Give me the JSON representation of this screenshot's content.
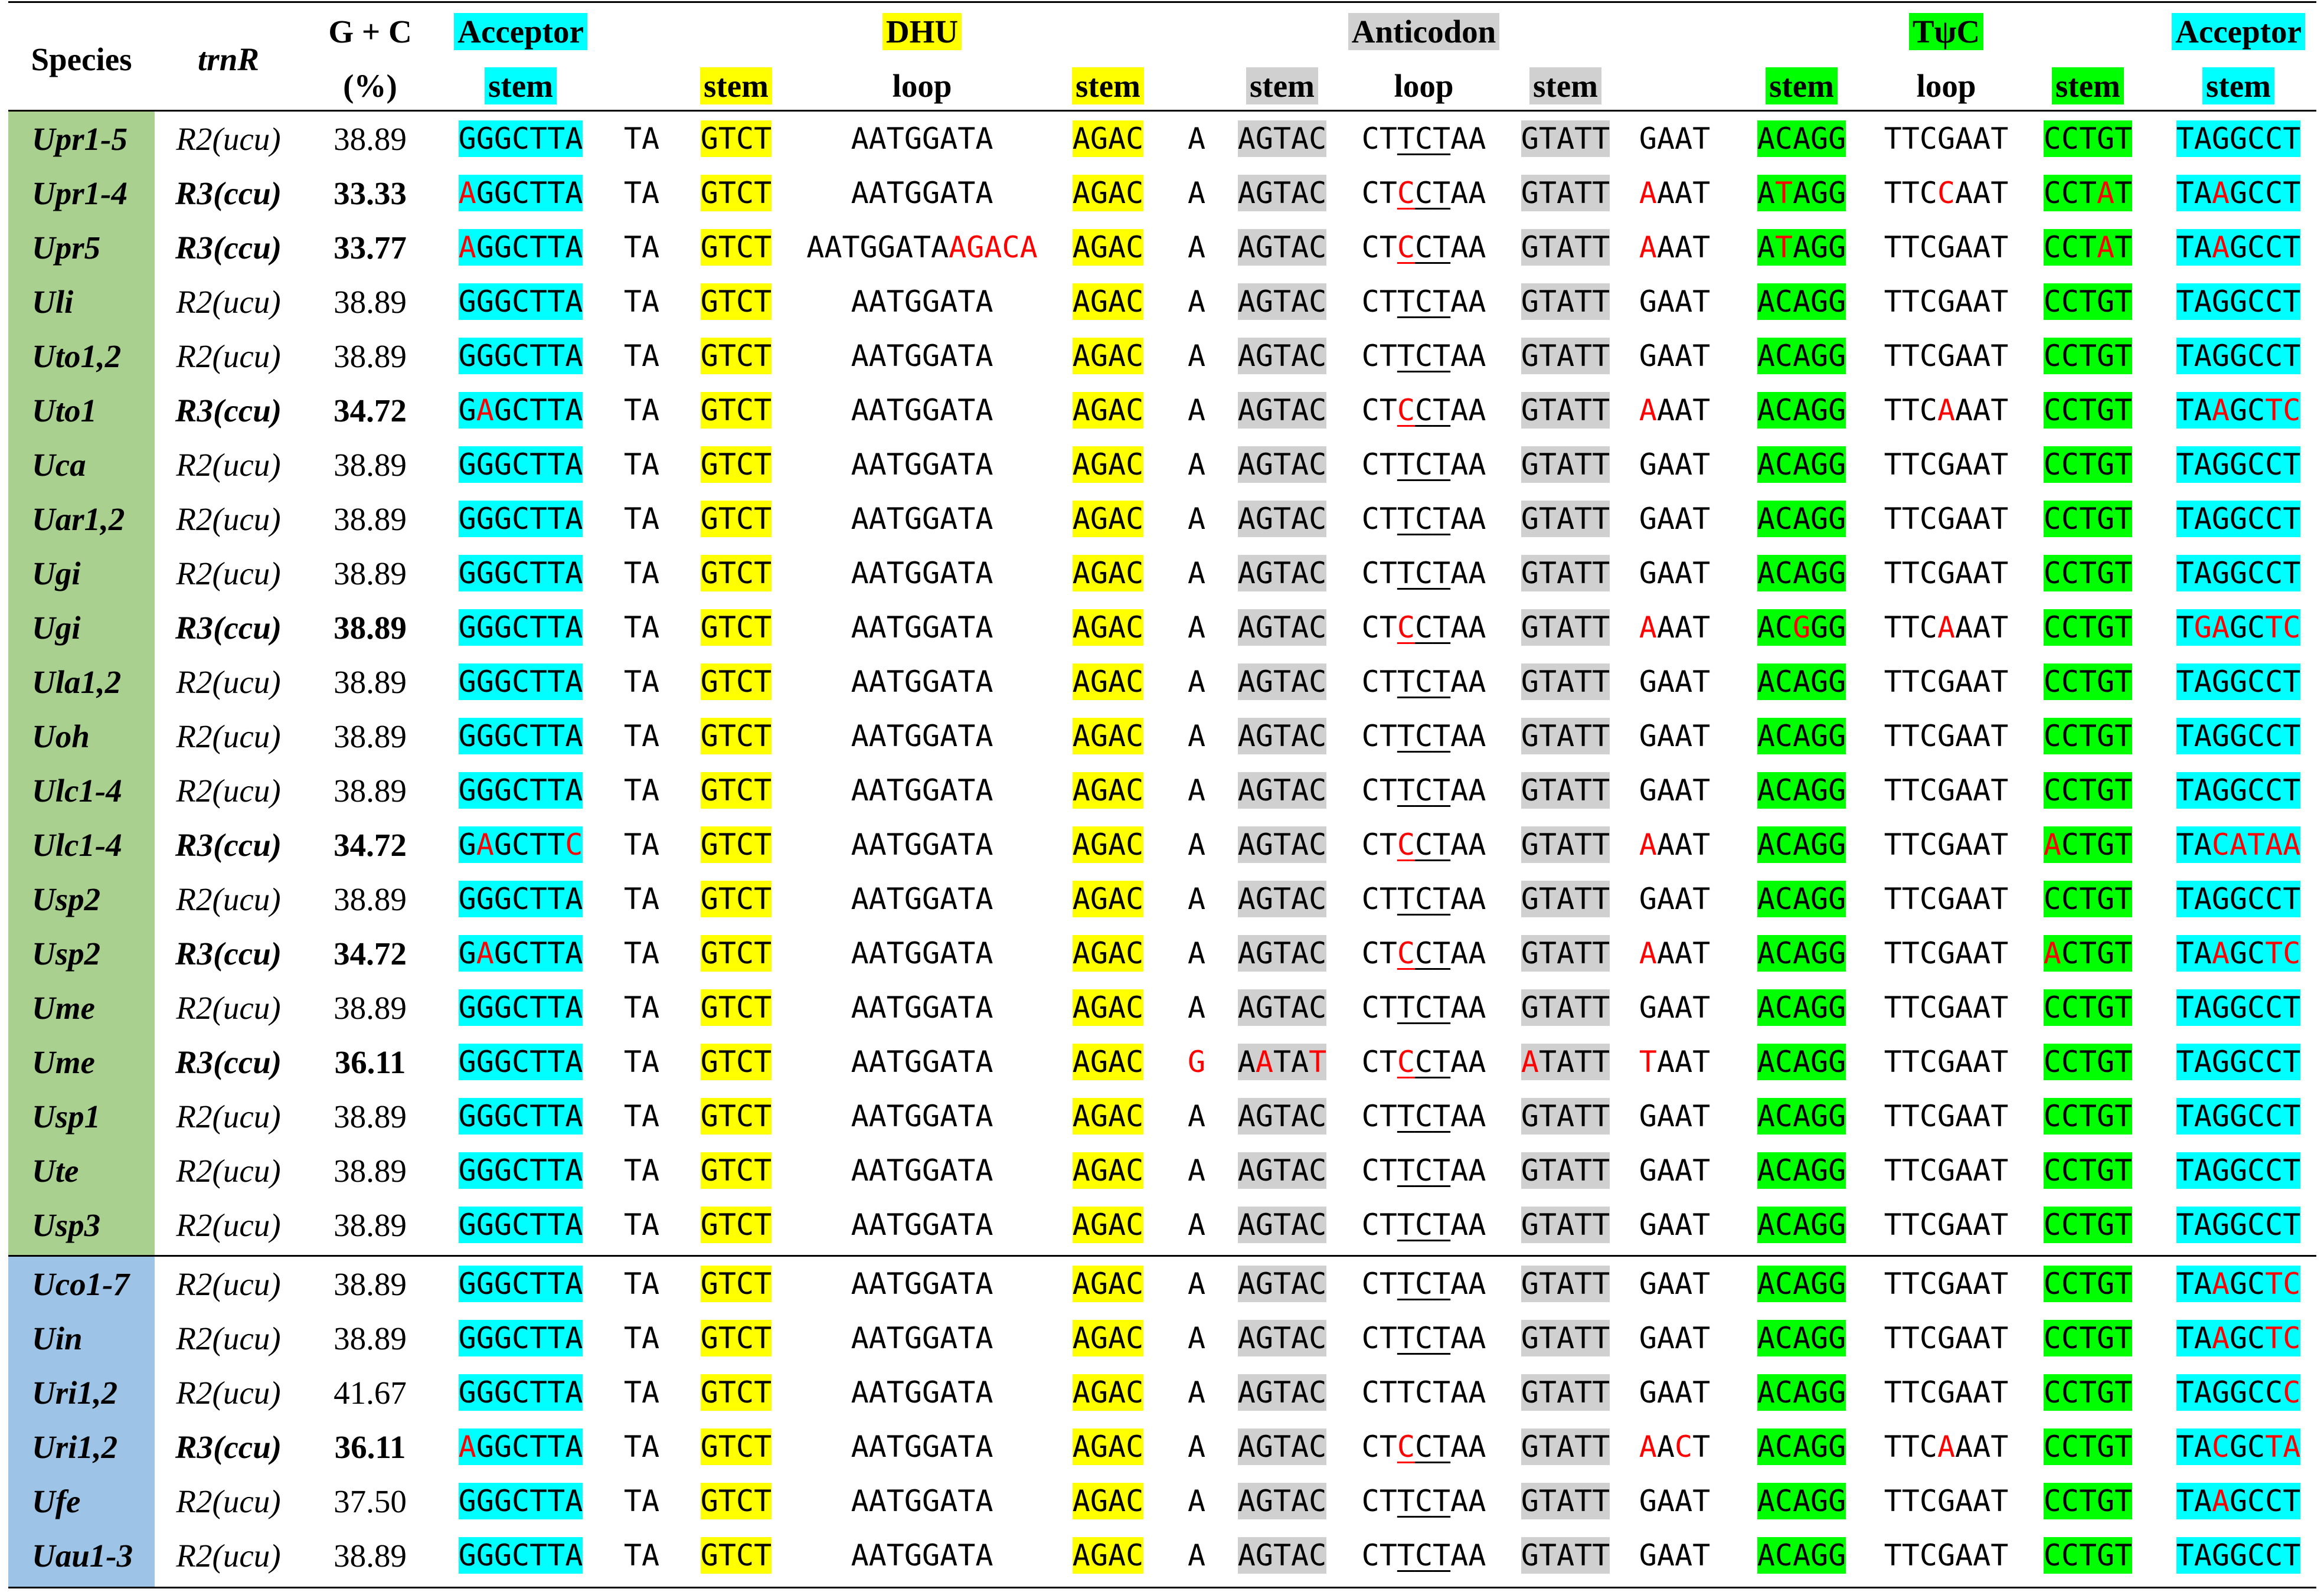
{
  "colors": {
    "acceptor": "#00ffff",
    "dhu": "#ffff00",
    "anticodon": "#d0d0d0",
    "tpsic": "#00ff00",
    "group_a": "#a9d08e",
    "group_b": "#9dc3e6",
    "mutation": "#ff0000"
  },
  "header": {
    "species": "Species",
    "trnr": "trnR",
    "gc_top": "G + C",
    "gc_bottom": "(%)",
    "acceptor_top": "Acceptor",
    "acceptor_stem": "stem",
    "dhu_top": "DHU",
    "dhu_stem1": "stem",
    "dhu_loop": "loop",
    "dhu_stem2": "stem",
    "anticodon_top": "Anticodon",
    "anticodon_stem1": "stem",
    "anticodon_loop": "loop",
    "anticodon_stem2": "stem",
    "tpsic_top": "TψC",
    "tpsic_stem1": "stem",
    "tpsic_loop": "loop",
    "tpsic_stem2": "stem",
    "acceptor2_top": "Acceptor",
    "acceptor2_stem": "stem"
  },
  "rows": [
    {
      "species": "Upr1-5",
      "group": "a",
      "trnr": "R2(ucu)",
      "bold": false,
      "gc": "38.89",
      "cols": [
        "GGGCTTA",
        "TA",
        "GTCT",
        "AATGGATA",
        "AGAC",
        "A",
        "AGTAC",
        "CTTCTAA",
        "GTATT",
        "GAAT",
        "ACAGG",
        "TTCGAAT",
        "CCTGT",
        "TAGGCCT"
      ]
    },
    {
      "species": "Upr1-4",
      "group": "a",
      "trnr": "R3(ccu)",
      "bold": true,
      "gc": "33.33",
      "cols": [
        "AGGCTTA",
        "TA",
        "GTCT",
        "AATGGATA",
        "AGAC",
        "A",
        "AGTAC",
        "CTCCTAA",
        "GTATT",
        "AAAT",
        "ATAGG",
        "TTCCAAT",
        "CCTAT",
        "TAAGCCT"
      ]
    },
    {
      "species": "Upr5",
      "group": "a",
      "trnr": "R3(ccu)",
      "bold": true,
      "gc": "33.77",
      "cols": [
        "AGGCTTA",
        "TA",
        "GTCT",
        "AATGGATAAGACA",
        "AGAC",
        "A",
        "AGTAC",
        "CTCCTAA",
        "GTATT",
        "AAAT",
        "ATAGG",
        "TTCGAAT",
        "CCTAT",
        "TAAGCCT"
      ]
    },
    {
      "species": "Uli",
      "group": "a",
      "trnr": "R2(ucu)",
      "bold": false,
      "gc": "38.89",
      "cols": [
        "GGGCTTA",
        "TA",
        "GTCT",
        "AATGGATA",
        "AGAC",
        "A",
        "AGTAC",
        "CTTCTAA",
        "GTATT",
        "GAAT",
        "ACAGG",
        "TTCGAAT",
        "CCTGT",
        "TAGGCCT"
      ]
    },
    {
      "species": "Uto1,2",
      "group": "a",
      "trnr": "R2(ucu)",
      "bold": false,
      "gc": "38.89",
      "cols": [
        "GGGCTTA",
        "TA",
        "GTCT",
        "AATGGATA",
        "AGAC",
        "A",
        "AGTAC",
        "CTTCTAA",
        "GTATT",
        "GAAT",
        "ACAGG",
        "TTCGAAT",
        "CCTGT",
        "TAGGCCT"
      ]
    },
    {
      "species": "Uto1",
      "group": "a",
      "trnr": "R3(ccu)",
      "bold": true,
      "gc": "34.72",
      "cols": [
        "GAGCTTA",
        "TA",
        "GTCT",
        "AATGGATA",
        "AGAC",
        "A",
        "AGTAC",
        "CTCCTAA",
        "GTATT",
        "AAAT",
        "ACAGG",
        "TTCAAAT",
        "CCTGT",
        "TAAGCTC"
      ]
    },
    {
      "species": "Uca",
      "group": "a",
      "trnr": "R2(ucu)",
      "bold": false,
      "gc": "38.89",
      "cols": [
        "GGGCTTA",
        "TA",
        "GTCT",
        "AATGGATA",
        "AGAC",
        "A",
        "AGTAC",
        "CTTCTAA",
        "GTATT",
        "GAAT",
        "ACAGG",
        "TTCGAAT",
        "CCTGT",
        "TAGGCCT"
      ]
    },
    {
      "species": "Uar1,2",
      "group": "a",
      "trnr": "R2(ucu)",
      "bold": false,
      "gc": "38.89",
      "cols": [
        "GGGCTTA",
        "TA",
        "GTCT",
        "AATGGATA",
        "AGAC",
        "A",
        "AGTAC",
        "CTTCTAA",
        "GTATT",
        "GAAT",
        "ACAGG",
        "TTCGAAT",
        "CCTGT",
        "TAGGCCT"
      ]
    },
    {
      "species": "Ugi",
      "group": "a",
      "trnr": "R2(ucu)",
      "bold": false,
      "gc": "38.89",
      "cols": [
        "GGGCTTA",
        "TA",
        "GTCT",
        "AATGGATA",
        "AGAC",
        "A",
        "AGTAC",
        "CTTCTAA",
        "GTATT",
        "GAAT",
        "ACAGG",
        "TTCGAAT",
        "CCTGT",
        "TAGGCCT"
      ]
    },
    {
      "species": "Ugi",
      "group": "a",
      "trnr": "R3(ccu)",
      "bold": true,
      "gc": "38.89",
      "cols": [
        "GGGCTTA",
        "TA",
        "GTCT",
        "AATGGATA",
        "AGAC",
        "A",
        "AGTAC",
        "CTCCTAA",
        "GTATT",
        "AAAT",
        "ACGGG",
        "TTCAAAT",
        "CCTGT",
        "TGAGCTC"
      ]
    },
    {
      "species": "Ula1,2",
      "group": "a",
      "trnr": "R2(ucu)",
      "bold": false,
      "gc": "38.89",
      "cols": [
        "GGGCTTA",
        "TA",
        "GTCT",
        "AATGGATA",
        "AGAC",
        "A",
        "AGTAC",
        "CTTCTAA",
        "GTATT",
        "GAAT",
        "ACAGG",
        "TTCGAAT",
        "CCTGT",
        "TAGGCCT"
      ]
    },
    {
      "species": "Uoh",
      "group": "a",
      "trnr": "R2(ucu)",
      "bold": false,
      "gc": "38.89",
      "cols": [
        "GGGCTTA",
        "TA",
        "GTCT",
        "AATGGATA",
        "AGAC",
        "A",
        "AGTAC",
        "CTTCTAA",
        "GTATT",
        "GAAT",
        "ACAGG",
        "TTCGAAT",
        "CCTGT",
        "TAGGCCT"
      ]
    },
    {
      "species": "Ulc1-4",
      "group": "a",
      "trnr": "R2(ucu)",
      "bold": false,
      "gc": "38.89",
      "cols": [
        "GGGCTTA",
        "TA",
        "GTCT",
        "AATGGATA",
        "AGAC",
        "A",
        "AGTAC",
        "CTTCTAA",
        "GTATT",
        "GAAT",
        "ACAGG",
        "TTCGAAT",
        "CCTGT",
        "TAGGCCT"
      ]
    },
    {
      "species": "Ulc1-4",
      "group": "a",
      "trnr": "R3(ccu)",
      "bold": true,
      "gc": "34.72",
      "cols": [
        "GAGCTTC",
        "TA",
        "GTCT",
        "AATGGATA",
        "AGAC",
        "A",
        "AGTAC",
        "CTCCTAA",
        "GTATT",
        "AAAT",
        "ACAGG",
        "TTCGAAT",
        "ACTGT",
        "TACATAA"
      ]
    },
    {
      "species": "Usp2",
      "group": "a",
      "trnr": "R2(ucu)",
      "bold": false,
      "gc": "38.89",
      "cols": [
        "GGGCTTA",
        "TA",
        "GTCT",
        "AATGGATA",
        "AGAC",
        "A",
        "AGTAC",
        "CTTCTAA",
        "GTATT",
        "GAAT",
        "ACAGG",
        "TTCGAAT",
        "CCTGT",
        "TAGGCCT"
      ]
    },
    {
      "species": "Usp2",
      "group": "a",
      "trnr": "R3(ccu)",
      "bold": true,
      "gc": "34.72",
      "cols": [
        "GAGCTTA",
        "TA",
        "GTCT",
        "AATGGATA",
        "AGAC",
        "A",
        "AGTAC",
        "CTCCTAA",
        "GTATT",
        "AAAT",
        "ACAGG",
        "TTCGAAT",
        "ACTGT",
        "TAAGCTC"
      ]
    },
    {
      "species": "Ume",
      "group": "a",
      "trnr": "R2(ucu)",
      "bold": false,
      "gc": "38.89",
      "cols": [
        "GGGCTTA",
        "TA",
        "GTCT",
        "AATGGATA",
        "AGAC",
        "A",
        "AGTAC",
        "CTTCTAA",
        "GTATT",
        "GAAT",
        "ACAGG",
        "TTCGAAT",
        "CCTGT",
        "TAGGCCT"
      ]
    },
    {
      "species": "Ume",
      "group": "a",
      "trnr": "R3(ccu)",
      "bold": true,
      "gc": "36.11",
      "cols": [
        "GGGCTTA",
        "TA",
        "GTCT",
        "AATGGATA",
        "AGAC",
        "G",
        "AATAT",
        "CTCCTAA",
        "ATATT",
        "TAAT",
        "ACAGG",
        "TTCGAAT",
        "CCTGT",
        "TAGGCCT"
      ]
    },
    {
      "species": "Usp1",
      "group": "a",
      "trnr": "R2(ucu)",
      "bold": false,
      "gc": "38.89",
      "cols": [
        "GGGCTTA",
        "TA",
        "GTCT",
        "AATGGATA",
        "AGAC",
        "A",
        "AGTAC",
        "CTTCTAA",
        "GTATT",
        "GAAT",
        "ACAGG",
        "TTCGAAT",
        "CCTGT",
        "TAGGCCT"
      ]
    },
    {
      "species": "Ute",
      "group": "a",
      "trnr": "R2(ucu)",
      "bold": false,
      "gc": "38.89",
      "cols": [
        "GGGCTTA",
        "TA",
        "GTCT",
        "AATGGATA",
        "AGAC",
        "A",
        "AGTAC",
        "CTTCTAA",
        "GTATT",
        "GAAT",
        "ACAGG",
        "TTCGAAT",
        "CCTGT",
        "TAGGCCT"
      ]
    },
    {
      "species": "Usp3",
      "group": "a",
      "trnr": "R2(ucu)",
      "bold": false,
      "gc": "38.89",
      "cols": [
        "GGGCTTA",
        "TA",
        "GTCT",
        "AATGGATA",
        "AGAC",
        "A",
        "AGTAC",
        "CTTCTAA",
        "GTATT",
        "GAAT",
        "ACAGG",
        "TTCGAAT",
        "CCTGT",
        "TAGGCCT"
      ]
    },
    {
      "species": "Uco1-7",
      "group": "b",
      "trnr": "R2(ucu)",
      "bold": false,
      "gc": "38.89",
      "cols": [
        "GGGCTTA",
        "TA",
        "GTCT",
        "AATGGATA",
        "AGAC",
        "A",
        "AGTAC",
        "CTTCTAA",
        "GTATT",
        "GAAT",
        "ACAGG",
        "TTCGAAT",
        "CCTGT",
        "TAAGCTC"
      ]
    },
    {
      "species": "Uin",
      "group": "b",
      "trnr": "R2(ucu)",
      "bold": false,
      "gc": "38.89",
      "cols": [
        "GGGCTTA",
        "TA",
        "GTCT",
        "AATGGATA",
        "AGAC",
        "A",
        "AGTAC",
        "CTTCTAA",
        "GTATT",
        "GAAT",
        "ACAGG",
        "TTCGAAT",
        "CCTGT",
        "TAAGCTC"
      ]
    },
    {
      "species": "Uri1,2",
      "group": "b",
      "trnr": "R2(ucu)",
      "bold": false,
      "gc": "41.67",
      "cols": [
        "GGGCTTA",
        "TA",
        "GTCT",
        "AATGGATA",
        "AGAC",
        "A",
        "AGTAC",
        "CTTCTAA",
        "GTATT",
        "GAAT",
        "ACAGG",
        "TTCGAAT",
        "CCTGT",
        "TAGGCCC"
      ]
    },
    {
      "species": "Uri1,2",
      "group": "b",
      "trnr": "R3(ccu)",
      "bold": true,
      "gc": "36.11",
      "cols": [
        "AGGCTTA",
        "TA",
        "GTCT",
        "AATGGATA",
        "AGAC",
        "A",
        "AGTAC",
        "CTCCTAA",
        "GTATT",
        "AACT",
        "ACAGG",
        "TTCAAAT",
        "CCTGT",
        "TACGCTA"
      ]
    },
    {
      "species": "Ufe",
      "group": "b",
      "trnr": "R2(ucu)",
      "bold": false,
      "gc": "37.50",
      "cols": [
        "GGGCTTA",
        "TA",
        "GTCT",
        "AATGGATA",
        "AGAC",
        "A",
        "AGTAC",
        "CTTCTAA",
        "GTATT",
        "GAAT",
        "ACAGG",
        "TTCGAAT",
        "CCTGT",
        "TAAGCCT"
      ]
    },
    {
      "species": "Uau1-3",
      "group": "b",
      "trnr": "R2(ucu)",
      "bold": false,
      "gc": "38.89",
      "cols": [
        "GGGCTTA",
        "TA",
        "GTCT",
        "AATGGATA",
        "AGAC",
        "A",
        "AGTAC",
        "CTTCTAA",
        "GTATT",
        "GAAT",
        "ACAGG",
        "TTCGAAT",
        "CCTGT",
        "TAGGCCT"
      ]
    }
  ]
}
